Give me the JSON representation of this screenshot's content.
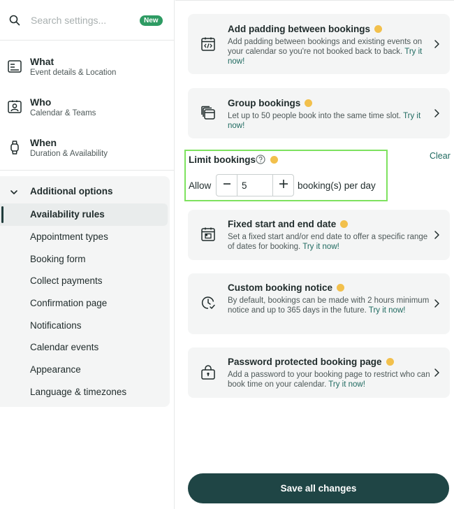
{
  "search": {
    "placeholder": "Search settings...",
    "badge": "New"
  },
  "nav": [
    {
      "title": "What",
      "subtitle": "Event details & Location",
      "icon": "id-card-icon"
    },
    {
      "title": "Who",
      "subtitle": "Calendar & Teams",
      "icon": "contact-card-icon"
    },
    {
      "title": "When",
      "subtitle": "Duration & Availability",
      "icon": "watch-icon"
    }
  ],
  "additional_options": {
    "title": "Additional options",
    "items": [
      {
        "label": "Availability rules",
        "active": true
      },
      {
        "label": "Appointment types"
      },
      {
        "label": "Booking form"
      },
      {
        "label": "Collect payments"
      },
      {
        "label": "Confirmation page"
      },
      {
        "label": "Notifications"
      },
      {
        "label": "Calendar events"
      },
      {
        "label": "Appearance"
      },
      {
        "label": "Language & timezones"
      }
    ]
  },
  "cards": {
    "padding": {
      "title": "Add padding between bookings",
      "desc": "Add padding between bookings and existing events on your calendar so you're not booked back to back.",
      "link": "Try it now!"
    },
    "group": {
      "title": "Group bookings",
      "desc": "Let up to 50 people book into the same time slot.",
      "link": "Try it now!"
    },
    "fixed": {
      "title": "Fixed start and end date",
      "desc": "Set a fixed start and/or end date to offer a specific range of dates for booking.",
      "link": "Try it now!"
    },
    "notice": {
      "title": "Custom booking notice",
      "desc": "By default, bookings can be made with 2 hours minimum notice and up to 365 days in the future.",
      "link": "Try it now!"
    },
    "password": {
      "title": "Password protected booking page",
      "desc": "Add a password to your booking page to restrict who can book time on your calendar.",
      "link": "Try it now!"
    }
  },
  "limit": {
    "title": "Limit bookings",
    "allow_label": "Allow",
    "value": "5",
    "per_day": "booking(s) per day",
    "clear": "Clear"
  },
  "save_label": "Save all changes",
  "colors": {
    "accent": "#1f4545",
    "link": "#1f6a60",
    "highlight_border": "#7ee25f",
    "badge": "#2e9b63",
    "premium": "#f2c04c"
  }
}
